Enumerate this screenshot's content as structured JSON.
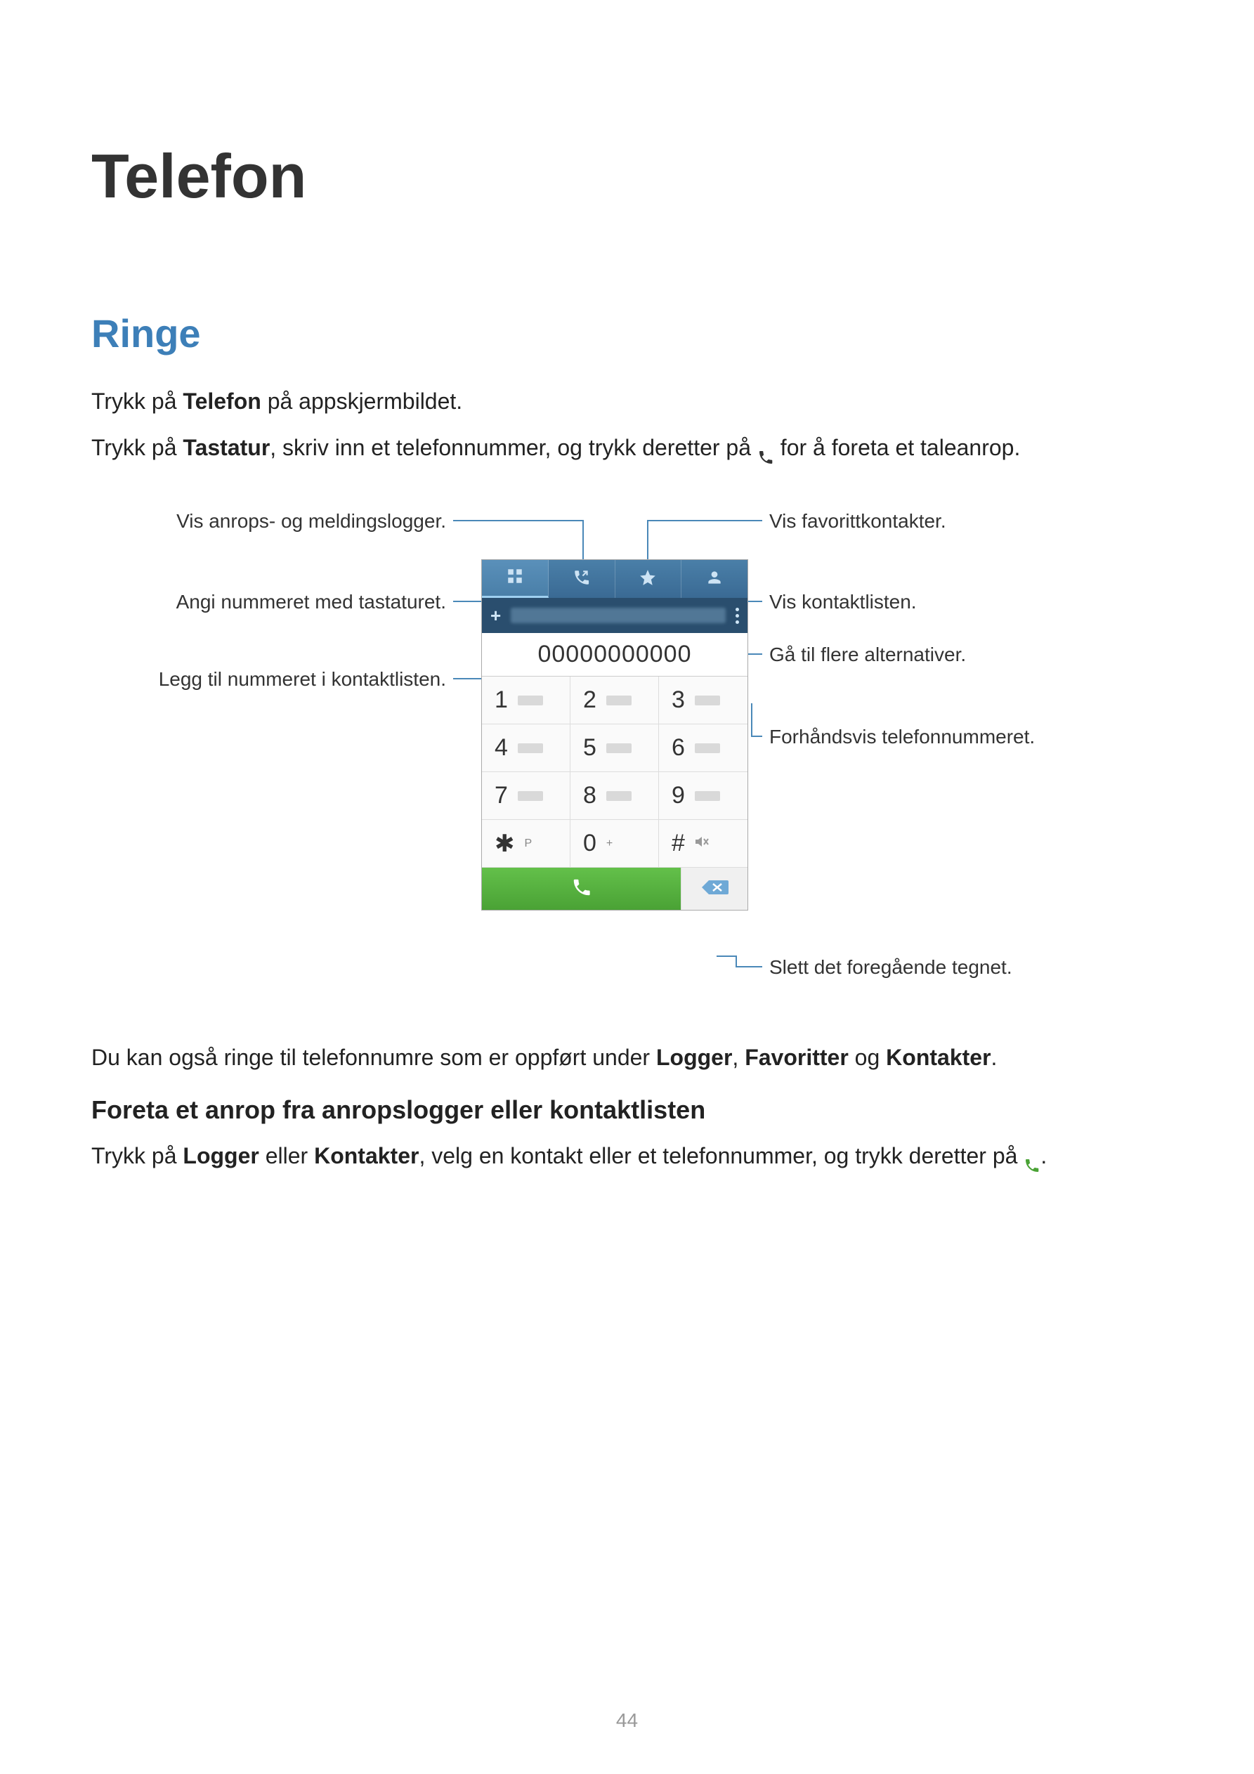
{
  "title": "Telefon",
  "section": "Ringe",
  "p1_pre": "Trykk på ",
  "p1_bold": "Telefon",
  "p1_post": " på appskjermbildet.",
  "p2_pre": "Trykk på ",
  "p2_bold": "Tastatur",
  "p2_mid": ", skriv inn et telefonnummer, og trykk deretter på ",
  "p2_post": " for å foreta et taleanrop.",
  "callouts": {
    "left1": "Vis anrops- og meldingslogger.",
    "left2": "Angi nummeret med tastaturet.",
    "left3": "Legg til nummeret i kontaktlisten.",
    "right1": "Vis favorittkontakter.",
    "right2": "Vis kontaktlisten.",
    "right3": "Gå til flere alternativer.",
    "right4": "Forhåndsvis telefonnummeret.",
    "right5": "Slett det foregående tegnet."
  },
  "dialer": {
    "number": "00000000000",
    "keys": {
      "k1": "1",
      "k2": "2",
      "k3": "3",
      "k4": "4",
      "k5": "5",
      "k6": "6",
      "k7": "7",
      "k8": "8",
      "k9": "9",
      "kstar": "✱",
      "kstar_sub": "P",
      "k0": "0",
      "k0_sub": "+",
      "khash": "#"
    }
  },
  "p3_pre": "Du kan også ringe til telefonnumre som er oppført under ",
  "p3_b1": "Logger",
  "p3_sep1": ", ",
  "p3_b2": "Favoritter",
  "p3_sep2": " og ",
  "p3_b3": "Kontakter",
  "p3_post": ".",
  "subsection": "Foreta et anrop fra anropslogger eller kontaktlisten",
  "p4_pre": "Trykk på ",
  "p4_b1": "Logger",
  "p4_mid1": " eller ",
  "p4_b2": "Kontakter",
  "p4_mid2": ", velg en kontakt eller et telefonnummer, og trykk deretter på ",
  "p4_post": ".",
  "page_num": "44"
}
